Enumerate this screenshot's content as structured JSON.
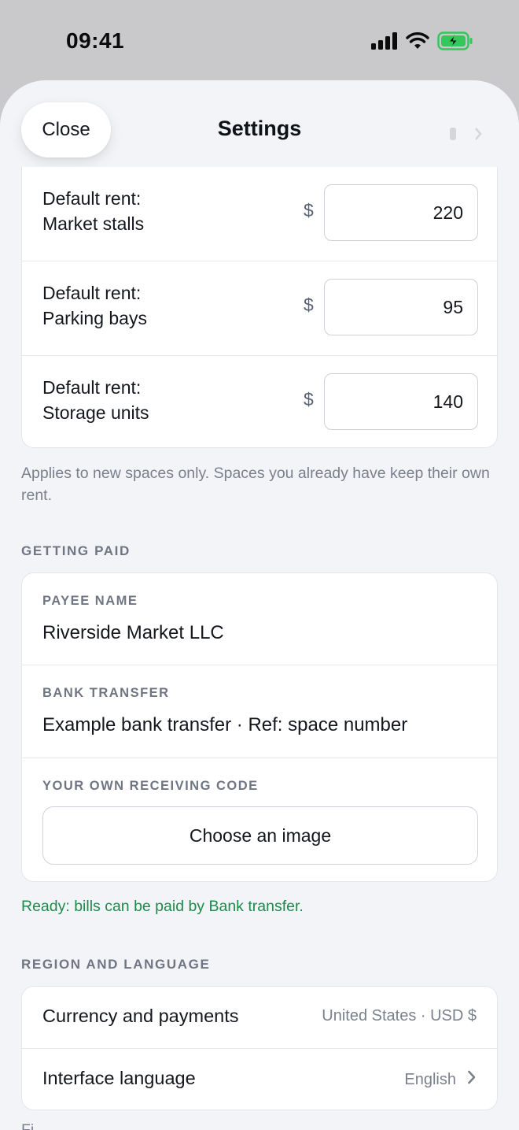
{
  "status_bar": {
    "time": "09:41"
  },
  "header": {
    "close_label": "Close",
    "title": "Settings"
  },
  "rent": {
    "currency_symbol": "$",
    "items": [
      {
        "label_line1": "Default rent:",
        "label_line2": "Market stalls",
        "value": "220"
      },
      {
        "label_line1": "Default rent:",
        "label_line2": "Parking bays",
        "value": "95"
      },
      {
        "label_line1": "Default rent:",
        "label_line2": "Storage units",
        "value": "140"
      }
    ],
    "helper": "Applies to new spaces only. Spaces you already have keep their own rent."
  },
  "getting_paid": {
    "section_label": "GETTING PAID",
    "payee_label": "PAYEE NAME",
    "payee_value": "Riverside Market LLC",
    "bank_label": "BANK TRANSFER",
    "bank_value": "Example bank transfer · Ref: space number",
    "code_label": "YOUR OWN RECEIVING CODE",
    "choose_image_label": "Choose an image",
    "ready_text": "Ready: bills can be paid by Bank transfer."
  },
  "region": {
    "section_label": "REGION AND LANGUAGE",
    "currency_label": "Currency and payments",
    "currency_value": "United States · USD $",
    "language_label": "Interface language",
    "language_value": "English"
  },
  "bottom_text": "Fi",
  "colors": {
    "ready_green": "#1e8a4c",
    "battery_green": "#34c759",
    "sheet_bg": "#f2f4f7"
  },
  "icons": {
    "signal": "cellular-signal-icon",
    "wifi": "wifi-icon",
    "battery": "battery-charging-icon",
    "chevron": "chevron-right-icon"
  }
}
